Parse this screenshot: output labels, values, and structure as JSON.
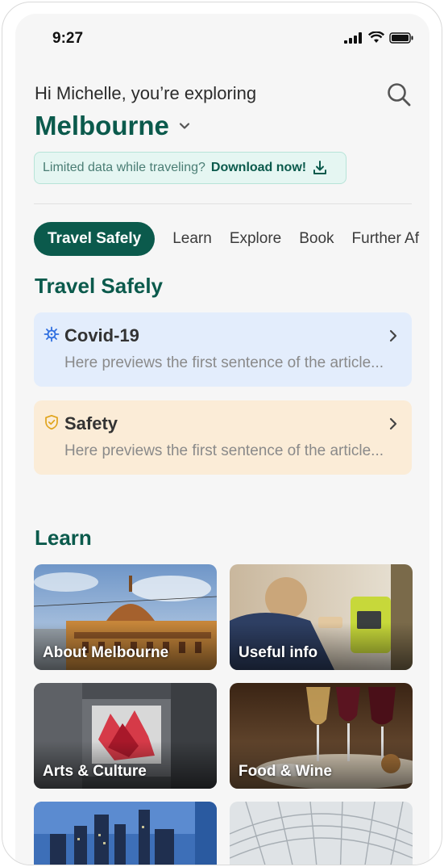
{
  "status": {
    "time": "9:27"
  },
  "header": {
    "greeting": "Hi Michelle, you’re exploring",
    "city": "Melbourne"
  },
  "banner": {
    "text": "Limited data while traveling?",
    "cta": "Download now!"
  },
  "tabs": [
    {
      "label": "Travel Safely",
      "active": true
    },
    {
      "label": "Learn"
    },
    {
      "label": "Explore"
    },
    {
      "label": "Book"
    },
    {
      "label": "Further Af"
    }
  ],
  "travel_safely": {
    "title": "Travel Safely",
    "cards": [
      {
        "title": "Covid-19",
        "preview": "Here previews the first sentence of the article...",
        "icon": "virus-icon"
      },
      {
        "title": "Safety",
        "preview": "Here previews the first sentence of the article...",
        "icon": "shield-check-icon"
      }
    ]
  },
  "learn": {
    "title": "Learn",
    "tiles": [
      {
        "label": "About Melbourne"
      },
      {
        "label": "Useful info"
      },
      {
        "label": "Arts & Culture"
      },
      {
        "label": "Food & Wine"
      },
      {
        "label": ""
      },
      {
        "label": ""
      }
    ]
  },
  "colors": {
    "brand": "#0b5a4c",
    "covid_card": "#e3edfc",
    "safety_card": "#fbecd7",
    "banner_bg": "#e5f6f2"
  }
}
